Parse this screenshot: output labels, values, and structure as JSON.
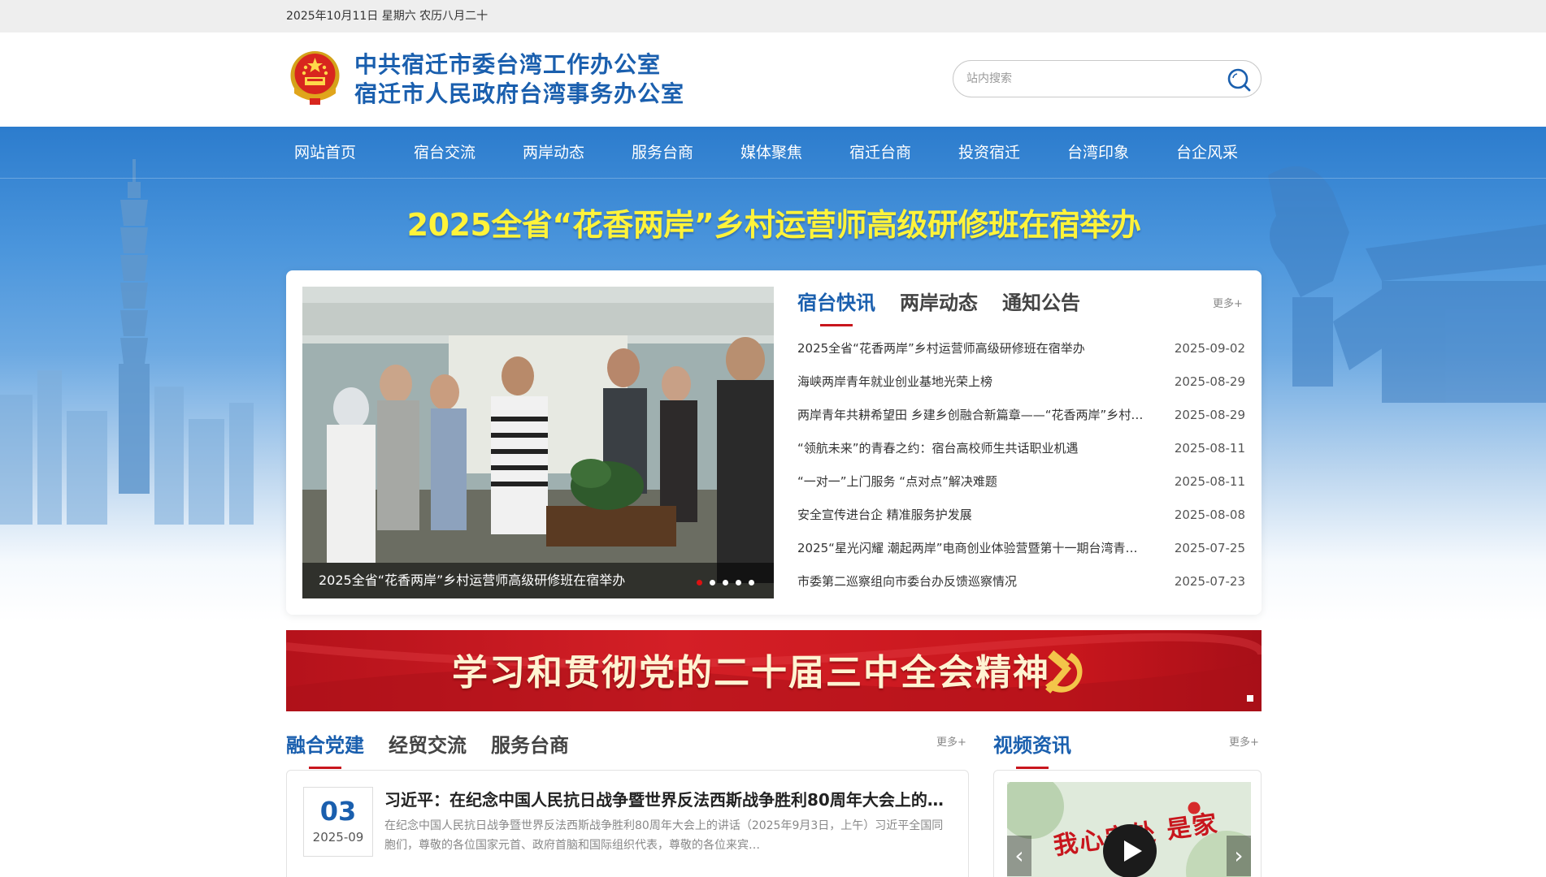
{
  "topbar": {
    "date": "2025年10月11日 星期六 农历八月二十"
  },
  "header": {
    "title_line1": "中共宿迁市委台湾工作办公室",
    "title_line2": "宿迁市人民政府台湾事务办公室",
    "search_placeholder": "站内搜索"
  },
  "nav": [
    "网站首页",
    "宿台交流",
    "两岸动态",
    "服务台商",
    "媒体聚焦",
    "宿迁台商",
    "投资宿迁",
    "台湾印象",
    "台企风采"
  ],
  "headline": "2025全省“花香两岸”乡村运营师高级研修班在宿举办",
  "slider": {
    "caption": "2025全省“花香两岸”乡村运营师高级研修班在宿举办",
    "dots": 5,
    "active_dot": 1
  },
  "news": {
    "tabs": [
      "宿台快讯",
      "两岸动态",
      "通知公告"
    ],
    "active_tab": 0,
    "more": "更多+",
    "items": [
      {
        "title": "2025全省“花香两岸”乡村运营师高级研修班在宿举办",
        "date": "2025-09-02"
      },
      {
        "title": "海峡两岸青年就业创业基地光荣上榜",
        "date": "2025-08-29"
      },
      {
        "title": "两岸青年共耕希望田 乡建乡创融合新篇章——“花香两岸”乡村…",
        "date": "2025-08-29"
      },
      {
        "title": "“领航未来”的青春之约：宿台高校师生共话职业机遇",
        "date": "2025-08-11"
      },
      {
        "title": "“一对一”上门服务 “点对点”解决难题",
        "date": "2025-08-11"
      },
      {
        "title": "安全宣传进台企 精准服务护发展",
        "date": "2025-08-08"
      },
      {
        "title": "2025“星光闪耀 潮起两岸”电商创业体验营暨第十一期台湾青…",
        "date": "2025-07-25"
      },
      {
        "title": "市委第二巡察组向市委台办反馈巡察情况",
        "date": "2025-07-23"
      }
    ]
  },
  "banner": {
    "text": "学习和贯彻党的二十届三中全会精神"
  },
  "section_left": {
    "tabs": [
      "融合党建",
      "经贸交流",
      "服务台商"
    ],
    "active_tab": 0,
    "more": "更多+",
    "article": {
      "day": "03",
      "year_month": "2025-09",
      "title": "习近平：在纪念中国人民抗日战争暨世界反法西斯战争胜利80周年大会上的…",
      "summary": "在纪念中国人民抗日战争暨世界反法西斯战争胜利80周年大会上的讲话（2025年9月3日，上午）习近平全国同胞们，尊敬的各位国家元首、政府首脑和国际组织代表，尊敬的各位来宾…"
    }
  },
  "section_right": {
    "title": "视频资讯",
    "more": "更多+",
    "video_text": "我心安处 是家"
  },
  "colors": {
    "brand_blue": "#1a5fae",
    "accent_red": "#c8161d",
    "headline_yellow": "#fff33a"
  }
}
